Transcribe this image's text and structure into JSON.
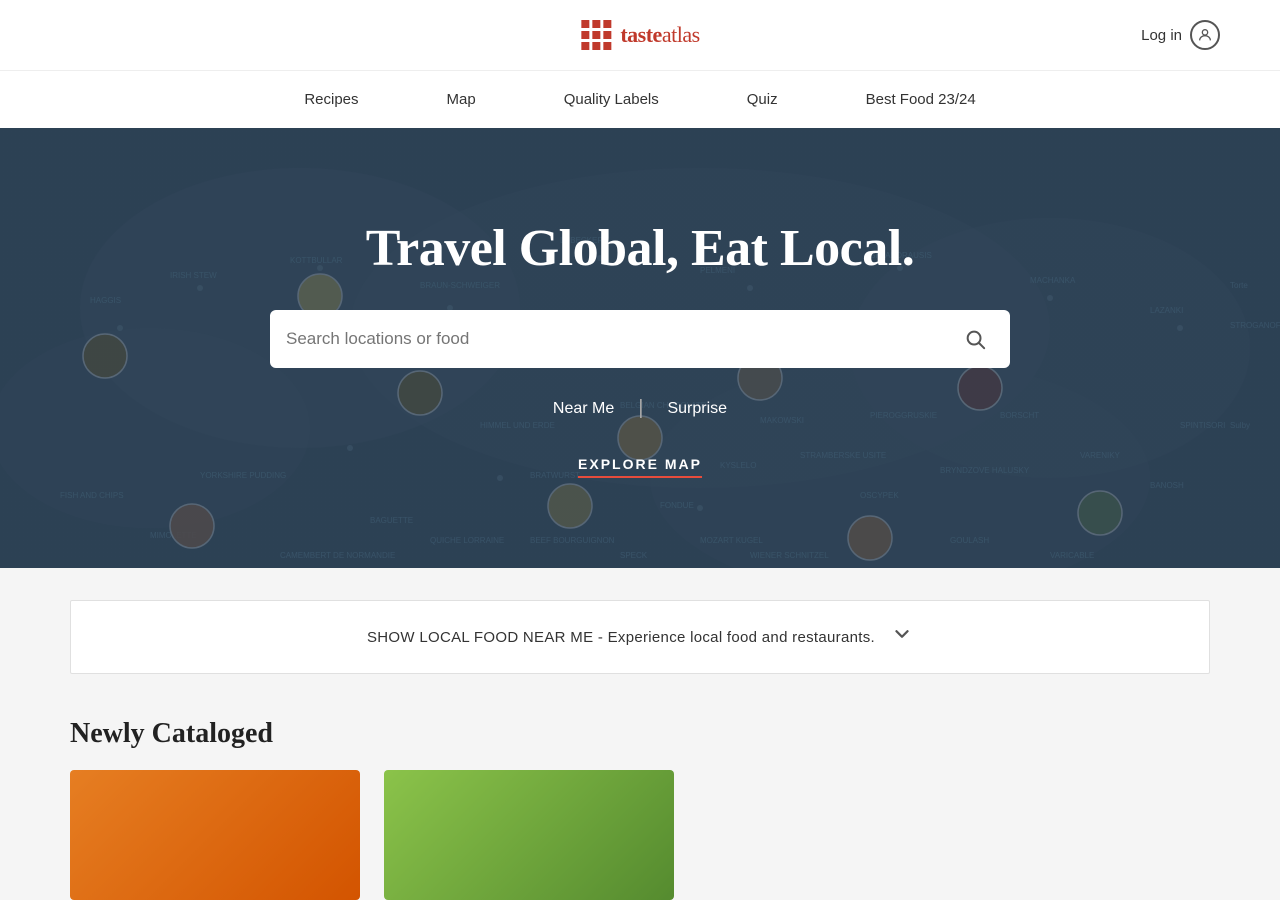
{
  "header": {
    "logo_text_prefix": "taste",
    "logo_text_suffix": "atlas",
    "login_label": "Log in"
  },
  "nav": {
    "items": [
      {
        "id": "recipes",
        "label": "Recipes"
      },
      {
        "id": "map",
        "label": "Map"
      },
      {
        "id": "quality-labels",
        "label": "Quality Labels"
      },
      {
        "id": "quiz",
        "label": "Quiz"
      },
      {
        "id": "best-food",
        "label": "Best Food 23/24"
      }
    ]
  },
  "hero": {
    "title": "Travel Global, Eat Local.",
    "search_placeholder": "Search locations or food",
    "search_icon": "🔍",
    "near_me_label": "Near Me",
    "surprise_label": "Surprise",
    "explore_map_label": "EXPLORE MAP"
  },
  "local_food_banner": {
    "text": "SHOW LOCAL FOOD NEAR ME - Experience local food and restaurants.",
    "chevron": "⌄"
  },
  "newly_cataloged": {
    "title": "Newly Cataloged"
  },
  "icons": {
    "user": "👤",
    "search": "🔍",
    "logo_grid": "▦"
  }
}
